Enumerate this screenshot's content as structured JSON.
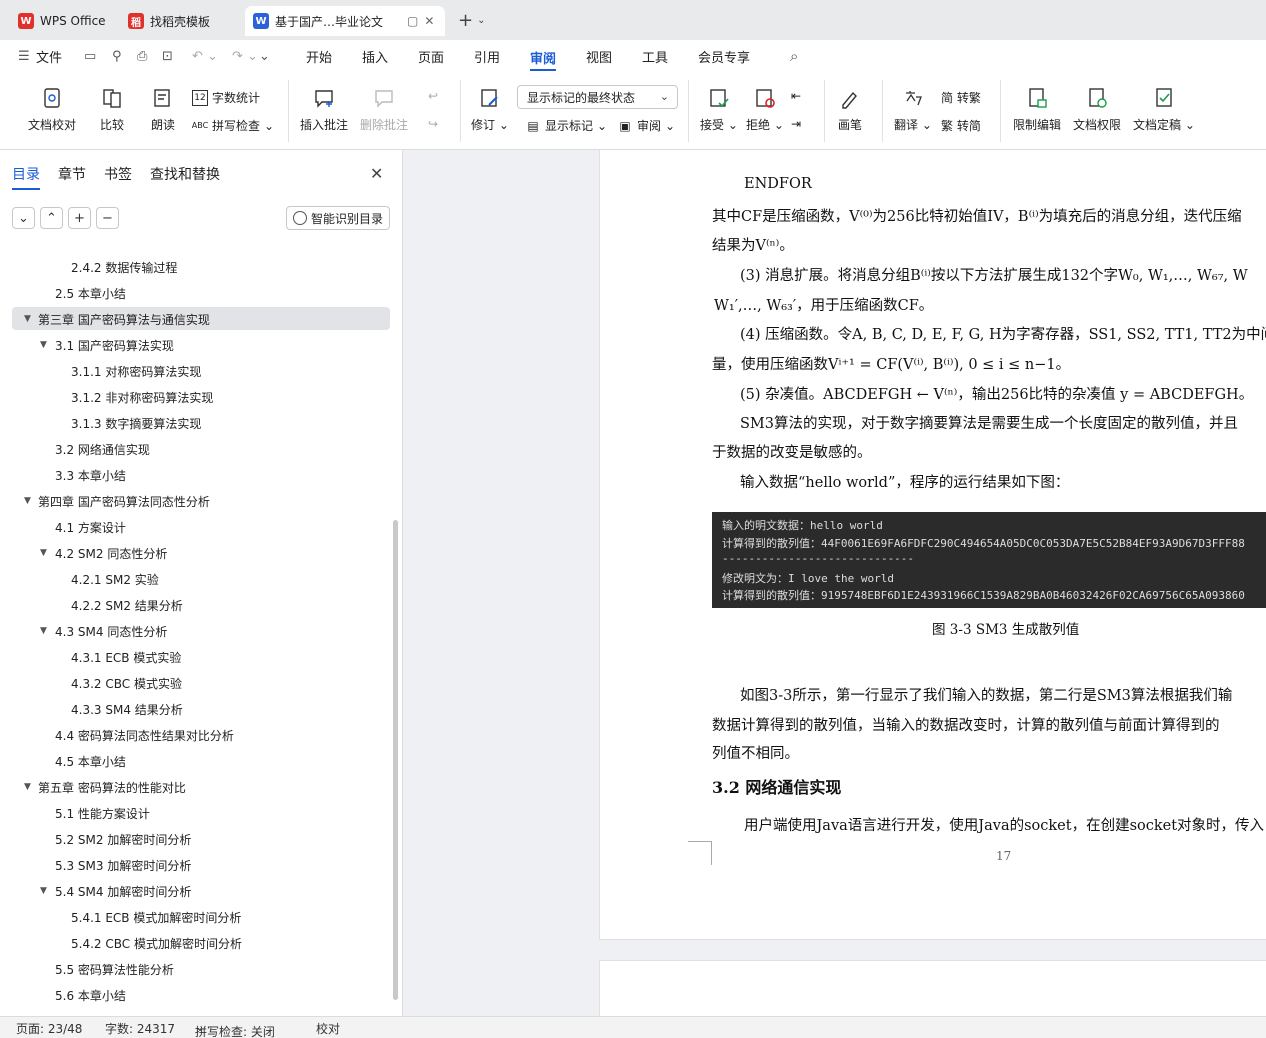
{
  "tabs": [
    {
      "label": "WPS Office",
      "logo": "W",
      "color": "#e0322c"
    },
    {
      "label": "找稻壳模板",
      "logo": "稻",
      "color": "#e0322c"
    },
    {
      "label": "基于国产…毕业论文",
      "logo": "W",
      "color": "#2b62d8"
    }
  ],
  "tab_controls": {
    "restore": "▢",
    "close": "✕"
  },
  "newtab": {
    "plus": "+",
    "chevron": "⌄"
  },
  "menu": {
    "file": "文件",
    "items": [
      "开始",
      "插入",
      "页面",
      "引用",
      "审阅",
      "视图",
      "工具",
      "会员专享"
    ],
    "active": "审阅",
    "quick_icons": [
      "save-icon",
      "link-icon",
      "print-icon",
      "preview-icon",
      "undo-icon",
      "redo-icon",
      "more-icon"
    ],
    "search_icon": "search-icon"
  },
  "ribbon": {
    "doc_check": "文档校对",
    "compare": "比较",
    "read": "朗读",
    "word_count": "字数统计",
    "spell_check": "拼写检查",
    "insert_comment": "插入批注",
    "delete_comment": "删除批注",
    "revise": "修订",
    "markup_state": "显示标记的最终状态",
    "show_markup": "显示标记",
    "review": "审阅",
    "accept": "接受",
    "reject": "拒绝",
    "pen": "画笔",
    "translate": "翻译",
    "trad": "简 转繁",
    "simp": "繁 转简",
    "restrict_edit": "限制编辑",
    "doc_perm": "文档权限",
    "finalize": "文档定稿"
  },
  "nav": {
    "tabs": [
      "目录",
      "章节",
      "书签",
      "查找和替换"
    ],
    "active": "目录",
    "smart": "智能识别目录",
    "buttons": [
      "⌄",
      "⌃",
      "+",
      "−"
    ]
  },
  "toc": [
    {
      "label": "2.4.2  数据传输过程",
      "level": 3
    },
    {
      "label": "2.5  本章小结",
      "level": 2
    },
    {
      "label": "第三章  国产密码算法与通信实现",
      "level": 1,
      "sel": true,
      "exp": true
    },
    {
      "label": "3.1  国产密码算法实现",
      "level": 2,
      "exp": true
    },
    {
      "label": "3.1.1  对称密码算法实现",
      "level": 3
    },
    {
      "label": "3.1.2  非对称密码算法实现",
      "level": 3
    },
    {
      "label": "3.1.3  数字摘要算法实现",
      "level": 3
    },
    {
      "label": "3.2  网络通信实现",
      "level": 2
    },
    {
      "label": "3.3  本章小结",
      "level": 2
    },
    {
      "label": "第四章  国产密码算法同态性分析",
      "level": 1,
      "exp": true
    },
    {
      "label": "4.1  方案设计",
      "level": 2
    },
    {
      "label": "4.2 SM2 同态性分析",
      "level": 2,
      "exp": true
    },
    {
      "label": "4.2.1 SM2 实验",
      "level": 3
    },
    {
      "label": "4.2.2 SM2 结果分析",
      "level": 3
    },
    {
      "label": "4.3 SM4 同态性分析",
      "level": 2,
      "exp": true
    },
    {
      "label": "4.3.1 ECB 模式实验",
      "level": 3
    },
    {
      "label": "4.3.2 CBC 模式实验",
      "level": 3
    },
    {
      "label": "4.3.3 SM4 结果分析",
      "level": 3
    },
    {
      "label": "4.4  密码算法同态性结果对比分析",
      "level": 2
    },
    {
      "label": "4.5 本章小结",
      "level": 2
    },
    {
      "label": "第五章  密码算法的性能对比",
      "level": 1,
      "exp": true
    },
    {
      "label": "5.1  性能方案设计",
      "level": 2
    },
    {
      "label": "5.2 SM2 加解密时间分析",
      "level": 2
    },
    {
      "label": "5.3 SM3 加解密时间分析",
      "level": 2
    },
    {
      "label": "5.4 SM4 加解密时间分析",
      "level": 2,
      "exp": true
    },
    {
      "label": "5.4.1 ECB 模式加解密时间分析",
      "level": 3
    },
    {
      "label": "5.4.2 CBC 模式加解密时间分析",
      "level": 3
    },
    {
      "label": "5.5  密码算法性能分析",
      "level": 2
    },
    {
      "label": "5.6  本章小结",
      "level": 2
    }
  ],
  "doc": {
    "lines": [
      "ENDFOR",
      "其中CF是压缩函数，V⁽⁰⁾为256比特初始值IV，B⁽ⁱ⁾为填充后的消息分组，迭代压缩",
      "结果为V⁽ⁿ⁾。",
      "(3)  消息扩展。将消息分组B⁽ⁱ⁾按以下方法扩展生成132个字W₀, W₁,…, W₆₇,  W",
      "W₁′,…,  W₆₃′，用于压缩函数CF。",
      "(4)  压缩函数。令A, B, C, D, E, F, G, H为字寄存器，SS1, SS2, TT1, TT2为中间",
      "量，使用压缩函数Vⁱ⁺¹ = CF(V⁽ⁱ⁾, B⁽ⁱ⁾), 0 ≤ i ≤ n−1。",
      "(5)  杂凑值。ABCDEFGH ← V⁽ⁿ⁾，输出256比特的杂凑值 y = ABCDEFGH。",
      "SM3算法的实现，对于数字摘要算法是需要生成一个长度固定的散列值，并且",
      "于数据的改变是敏感的。",
      "输入数据“hello world”，程序的运行结果如下图："
    ],
    "code": [
      "输入的明文数据：hello world",
      "计算得到的散列值：44F0061E69FA6FDFC290C494654A05DC0C053DA7E5C52B84EF93A9D67D3FFF88",
      "-----------------------------",
      "修改明文为：I love the world",
      "计算得到的散列值：9195748EBF6D1E243931966C1539A829BA0B46032426F02CA69756C65A093860"
    ],
    "caption": "图 3-3 SM3 生成散列值",
    "para2": [
      "如图3-3所示，第一行显示了我们输入的数据，第二行是SM3算法根据我们输",
      "数据计算得到的散列值，当输入的数据改变时，计算的散列值与前面计算得到的",
      "列值不相同。"
    ],
    "heading": "3.2  网络通信实现",
    "para3": "用户端使用Java语言进行开发，使用Java的socket，在创建socket对象时，传入",
    "page_number": "17"
  },
  "status": {
    "page": "页面: 23/48",
    "words": "字数: 24317",
    "spell": "拼写检查: 关闭",
    "proof": "校对"
  }
}
